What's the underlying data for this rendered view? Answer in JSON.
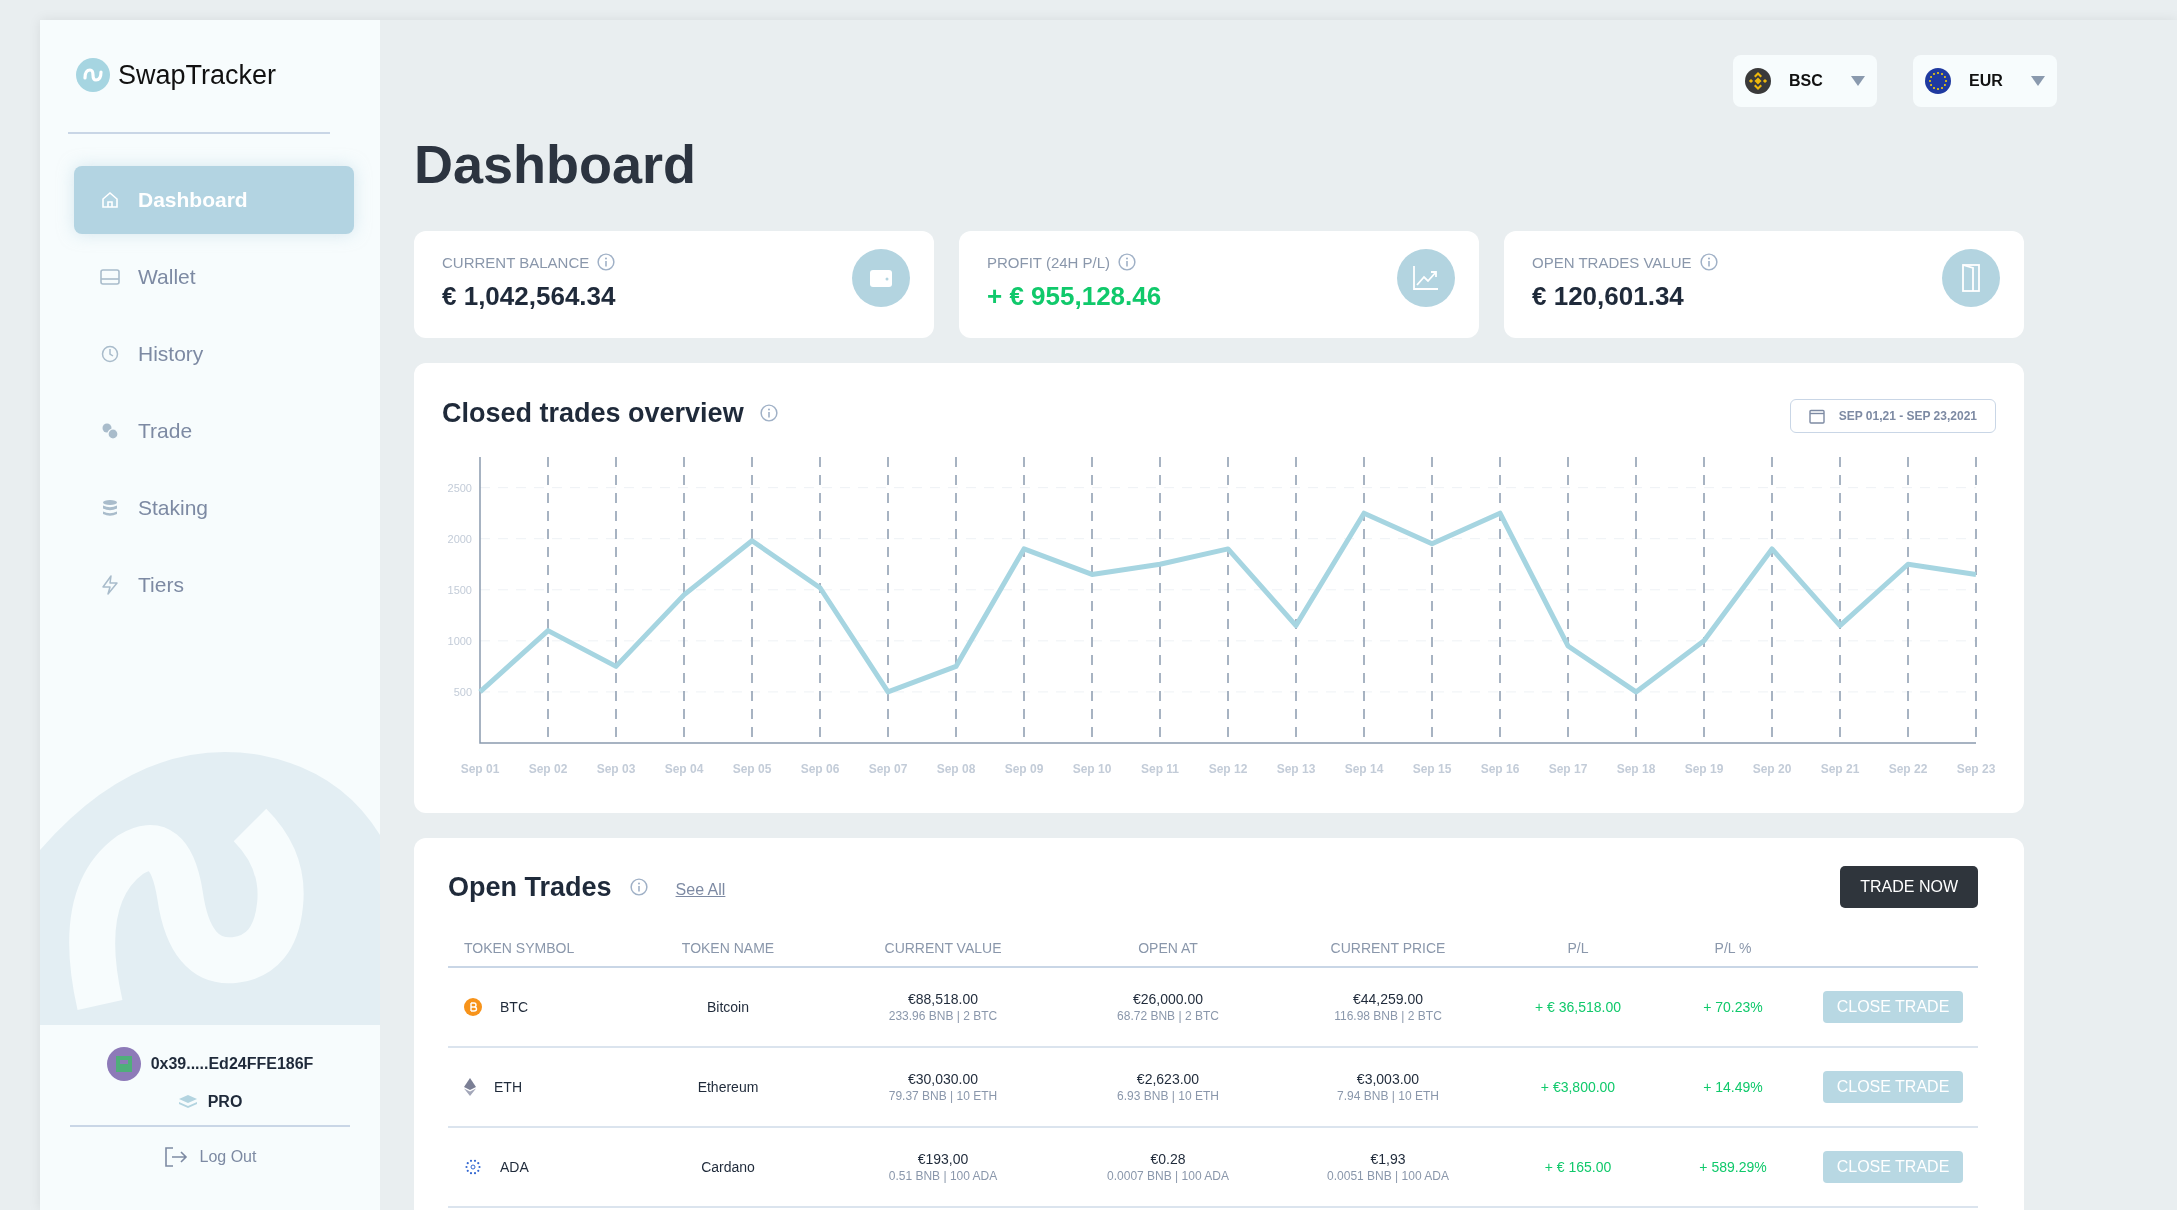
{
  "sidebar": {
    "logo": "SwapTracker",
    "nav": [
      {
        "label": "Dashboard",
        "kind": "home",
        "selected": true
      },
      {
        "label": "Wallet",
        "kind": "wallet",
        "selected": false
      },
      {
        "label": "History",
        "kind": "clock",
        "selected": false
      },
      {
        "label": "Trade",
        "kind": "coins",
        "selected": false
      },
      {
        "label": "Staking",
        "kind": "stack",
        "selected": false
      },
      {
        "label": "Tiers",
        "kind": "bolt",
        "selected": false
      }
    ],
    "user": {
      "address": "0x39.....Ed24FFE186F",
      "tier": "PRO"
    },
    "logout": "Log Out"
  },
  "header": {
    "title": "Dashboard",
    "selectors": [
      {
        "label": "BSC",
        "kind": "bsc"
      },
      {
        "label": "EUR",
        "kind": "eur"
      }
    ]
  },
  "stats": [
    {
      "label": "CURRENT BALANCE",
      "value": "€ 1,042,564.34",
      "positive": false,
      "kind": "wallet"
    },
    {
      "label": "PROFIT (24H P/L)",
      "value": "+ € 955,128.46",
      "positive": true,
      "kind": "chart"
    },
    {
      "label": "OPEN TRADES VALUE",
      "value": "€ 120,601.34",
      "positive": false,
      "kind": "door"
    }
  ],
  "closed_trades": {
    "title": "Closed trades overview",
    "date_range": "SEP 01,21 - SEP 23,2021",
    "chart_data": {
      "type": "line",
      "categories": [
        "Sep 01",
        "Sep 02",
        "Sep 03",
        "Sep 04",
        "Sep 05",
        "Sep 06",
        "Sep 07",
        "Sep 08",
        "Sep 09",
        "Sep 10",
        "Sep 11",
        "Sep 12",
        "Sep 13",
        "Sep 14",
        "Sep 15",
        "Sep 16",
        "Sep 17",
        "Sep 18",
        "Sep 19",
        "Sep 20",
        "Sep 21",
        "Sep 22",
        "Sep 23"
      ],
      "grid": true,
      "series": [
        {
          "color": "#a6d5e1",
          "values": [
            500,
            1100,
            750,
            1450,
            1980,
            1520,
            500,
            750,
            1900,
            1650,
            1750,
            1900,
            1150,
            2250,
            1950,
            2250,
            950,
            500,
            1000,
            1900,
            1150,
            1750,
            1650
          ]
        }
      ],
      "ylim": [
        0,
        2800
      ],
      "yticks": [
        500,
        1000,
        1500,
        2000,
        2500
      ]
    }
  },
  "open_trades": {
    "title": "Open Trades",
    "see_all": "See All",
    "button": "TRADE NOW",
    "columns": [
      "TOKEN SYMBOL",
      "TOKEN NAME",
      "CURRENT VALUE",
      "OPEN AT",
      "CURRENT PRICE",
      "P/L",
      "P/L %"
    ],
    "rows": [
      {
        "kind": "btc",
        "symbol": "BTC",
        "name": "Bitcoin",
        "current_value": "€88,518.00",
        "current_value_sub": "233.96 BNB | 2 BTC",
        "open_at": "€26,000.00",
        "open_at_sub": "68.72 BNB | 2 BTC",
        "current_price": "€44,259.00",
        "current_price_sub": "116.98 BNB | 2 BTC",
        "pl": "+ € 36,518.00",
        "pl_pct": "+ 70.23%",
        "action": "CLOSE TRADE"
      },
      {
        "kind": "eth",
        "symbol": "ETH",
        "name": "Ethereum",
        "current_value": "€30,030.00",
        "current_value_sub": "79.37 BNB | 10 ETH",
        "open_at": "€2,623.00",
        "open_at_sub": "6.93 BNB | 10 ETH",
        "current_price": "€3,003.00",
        "current_price_sub": "7.94 BNB | 10 ETH",
        "pl": "+ €3,800.00",
        "pl_pct": "+ 14.49%",
        "action": "CLOSE TRADE"
      },
      {
        "kind": "ada",
        "symbol": "ADA",
        "name": "Cardano",
        "current_value": "€193,00",
        "current_value_sub": "0.51 BNB | 100 ADA",
        "open_at": "€0.28",
        "open_at_sub": "0.0007 BNB | 100 ADA",
        "current_price": "€1,93",
        "current_price_sub": "0.0051 BNB | 100 ADA",
        "pl": "+ € 165.00",
        "pl_pct": "+ 589.29%",
        "action": "CLOSE TRADE"
      }
    ]
  }
}
